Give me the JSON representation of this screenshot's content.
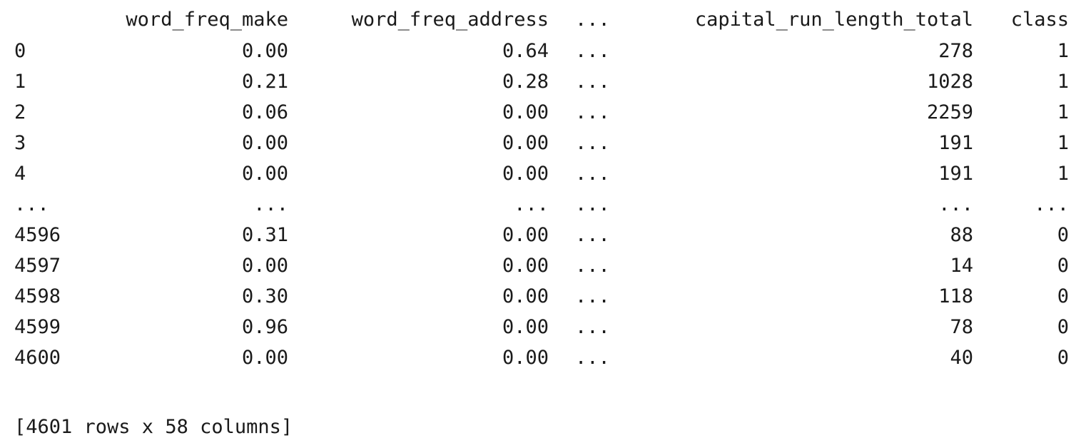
{
  "columns": [
    "word_freq_make",
    "word_freq_address",
    "...",
    "capital_run_length_total",
    "class"
  ],
  "rows": [
    [
      "0",
      "0.00",
      "0.64",
      "...",
      "278",
      "1"
    ],
    [
      "1",
      "0.21",
      "0.28",
      "...",
      "1028",
      "1"
    ],
    [
      "2",
      "0.06",
      "0.00",
      "...",
      "2259",
      "1"
    ],
    [
      "3",
      "0.00",
      "0.00",
      "...",
      "191",
      "1"
    ],
    [
      "4",
      "0.00",
      "0.00",
      "...",
      "191",
      "1"
    ],
    [
      "...",
      "...",
      "...",
      "...",
      "...",
      "..."
    ],
    [
      "4596",
      "0.31",
      "0.00",
      "...",
      "88",
      "0"
    ],
    [
      "4597",
      "0.00",
      "0.00",
      "...",
      "14",
      "0"
    ],
    [
      "4598",
      "0.30",
      "0.00",
      "...",
      "118",
      "0"
    ],
    [
      "4599",
      "0.96",
      "0.00",
      "...",
      "78",
      "0"
    ],
    [
      "4600",
      "0.00",
      "0.00",
      "...",
      "40",
      "0"
    ]
  ],
  "shape": "[4601 rows x 58 columns]"
}
